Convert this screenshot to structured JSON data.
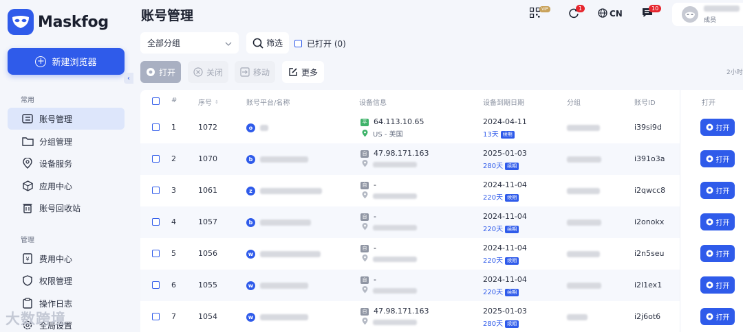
{
  "app": {
    "name": "Maskfog"
  },
  "sidebar": {
    "new_button": "新建浏览器",
    "sections": [
      {
        "title": "常用"
      },
      {
        "title": "管理"
      }
    ],
    "items": [
      {
        "label": "账号管理",
        "icon": "account-list-icon",
        "active": true
      },
      {
        "label": "分组管理",
        "icon": "folder-icon"
      },
      {
        "label": "设备服务",
        "icon": "location-icon"
      },
      {
        "label": "应用中心",
        "icon": "cube-icon"
      },
      {
        "label": "账号回收站",
        "icon": "trash-icon"
      },
      {
        "label": "费用中心",
        "icon": "billing-icon"
      },
      {
        "label": "权限管理",
        "icon": "shield-icon"
      },
      {
        "label": "操作日志",
        "icon": "clipboard-icon"
      },
      {
        "label": "全局设置",
        "icon": "gear-icon"
      }
    ],
    "watermark": "大数跨境"
  },
  "header": {
    "title": "账号管理",
    "vip_label": "VIP",
    "sync_badge": "1",
    "language": "CN",
    "message_badge": "10",
    "user_role": "成员"
  },
  "toolbar": {
    "group_select": "全部分组",
    "filter": "筛选",
    "opened_filter": "已打开 (0)",
    "actions": {
      "open": "打开",
      "close": "关闭",
      "move": "移动",
      "more": "更多"
    },
    "right_note": "2小时"
  },
  "table": {
    "columns": [
      "#",
      "序号",
      "账号平台/名称",
      "设备信息",
      "设备到期日期",
      "分组",
      "账号ID",
      "打开"
    ],
    "open_label": "打开",
    "renew_label": "续期",
    "rows": [
      {
        "index": "1",
        "seq": "1072",
        "platform": "o",
        "device_tag": "平",
        "ip": "64.113.10.65",
        "location": "US - 美国",
        "expiry": "2024-04-11",
        "days": "13天",
        "account_id": "i39si9d"
      },
      {
        "index": "2",
        "seq": "1070",
        "platform": "b",
        "device_tag": "自",
        "ip": "47.98.171.163",
        "location": "",
        "expiry": "2025-01-03",
        "days": "280天",
        "account_id": "i391o3a"
      },
      {
        "index": "3",
        "seq": "1061",
        "platform": "z",
        "device_tag": "自",
        "ip": "-",
        "location": "",
        "expiry": "2024-11-04",
        "days": "220天",
        "account_id": "i2qwcc8"
      },
      {
        "index": "4",
        "seq": "1057",
        "platform": "b",
        "device_tag": "自",
        "ip": "-",
        "location": "",
        "expiry": "2024-11-04",
        "days": "220天",
        "account_id": "i2onokx"
      },
      {
        "index": "5",
        "seq": "1056",
        "platform": "w",
        "device_tag": "自",
        "ip": "-",
        "location": "",
        "expiry": "2024-11-04",
        "days": "220天",
        "account_id": "i2n5seu"
      },
      {
        "index": "6",
        "seq": "1055",
        "platform": "w",
        "device_tag": "自",
        "ip": "-",
        "location": "",
        "expiry": "2024-11-04",
        "days": "220天",
        "account_id": "i2l1ex1"
      },
      {
        "index": "7",
        "seq": "1054",
        "platform": "w",
        "device_tag": "自",
        "ip": "47.98.171.163",
        "location": "",
        "expiry": "2025-01-03",
        "days": "280天",
        "account_id": "i2j6ot6"
      }
    ]
  },
  "colors": {
    "primary": "#2f5bea",
    "badge_red": "#e6262e",
    "tag_green": "#3fb36a"
  }
}
